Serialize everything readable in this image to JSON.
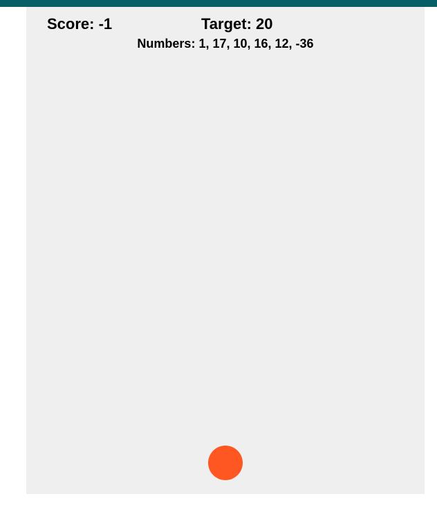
{
  "hud": {
    "score_text": "Score: -1",
    "target_text": "Target: 20",
    "numbers_text": "Numbers: 1, 17, 10, 16, 12, -36"
  },
  "game": {
    "score": -1,
    "target": 20,
    "numbers": [
      1,
      17,
      10,
      16,
      12,
      -36
    ]
  },
  "colors": {
    "top_bar": "#055f64",
    "playfield": "#efefef",
    "ball": "#ff5722"
  }
}
